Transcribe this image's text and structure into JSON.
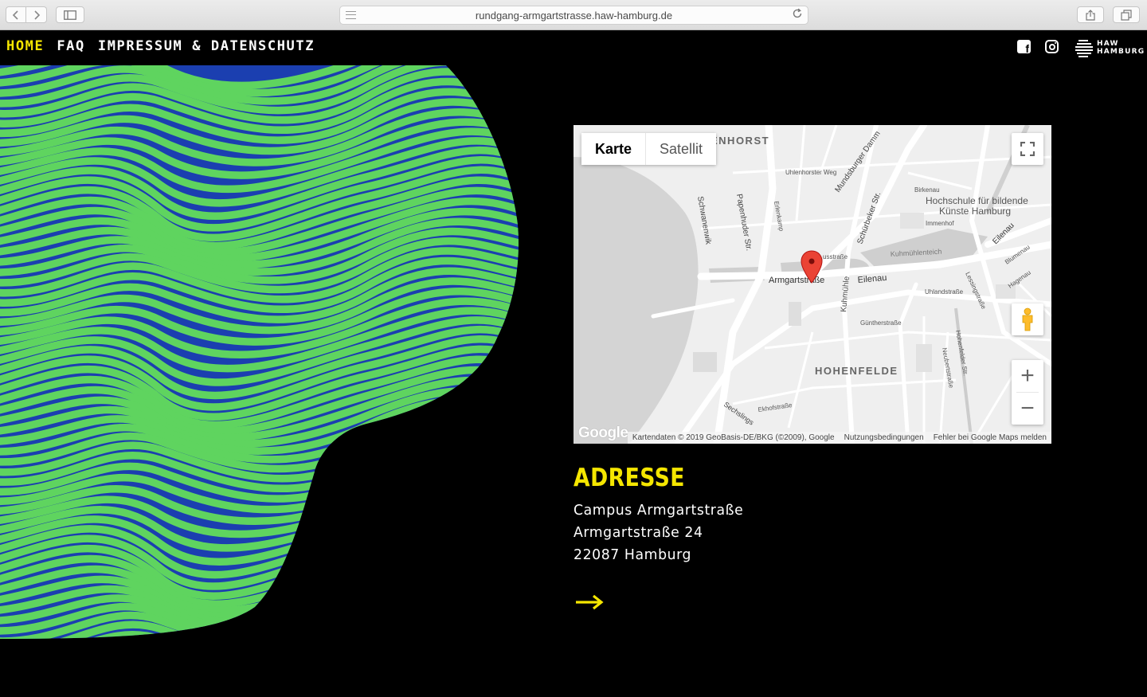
{
  "browser": {
    "url": "rundgang-armgartstrasse.haw-hamburg.de"
  },
  "nav": {
    "items": [
      {
        "label": "HOME",
        "active": true
      },
      {
        "label": "FAQ",
        "active": false
      },
      {
        "label": "IMPRESSUM & DATENSCHUTZ",
        "active": false
      }
    ]
  },
  "logo": {
    "line1": "HAW",
    "line2": "HAMBURG"
  },
  "map": {
    "type_buttons": [
      "Karte",
      "Satellit"
    ],
    "zoom_in": "+",
    "zoom_out": "−",
    "labels": {
      "uhlenhorst": "ENHORST",
      "hohenfelde": "HOHENFELDE",
      "hochschule1": "Hochschule für bildende",
      "hochschule2": "Künste Hamburg",
      "armgart": "Armgartstraße",
      "eilenau": "Eilenau",
      "eilenau2": "Eilenau",
      "schwanenwik": "Schwanenwik",
      "papenhuder": "Papenhuder Str.",
      "mundsburger": "Mundsburger Damm",
      "schurbeker": "Schürbeker Str.",
      "kuhmuhle": "Kuhmühle",
      "kuhmuhlenteich": "Kuhmühlenteich",
      "uhlenhorster_weg": "Uhlenhorster Weg",
      "birkenau": "Birkenau",
      "immenhof": "Immenhof",
      "uhlandstrasse": "Uhlandstraße",
      "guntherstrasse": "Güntherstraße",
      "ekhofstrasse": "Ekhofstraße",
      "sechslingspforte": "Sechslings",
      "lessingstrasse": "Lessingstraße",
      "hohenfelder_str": "Hohenfelder Str.",
      "neubertstrasse": "Neubertstraße",
      "blumenau": "Blumenau",
      "hagenau": "Hagenau",
      "erlenkamp": "Erlenkamp",
      "ussstrasse": "usstraße"
    },
    "google": "Google",
    "attribution": [
      "Kartendaten © 2019 GeoBasis-DE/BKG (©2009), Google",
      "Nutzungsbedingungen",
      "Fehler bei Google Maps melden"
    ]
  },
  "address": {
    "title": "ADRESSE",
    "lines": [
      "Campus Armgartstraße",
      "Armgartstraße 24",
      "22087 Hamburg"
    ]
  },
  "colors": {
    "accent_yellow": "#f5e600",
    "art_green": "#5fd45f",
    "art_blue": "#1b3fb0",
    "marker_red": "#ea4335"
  }
}
